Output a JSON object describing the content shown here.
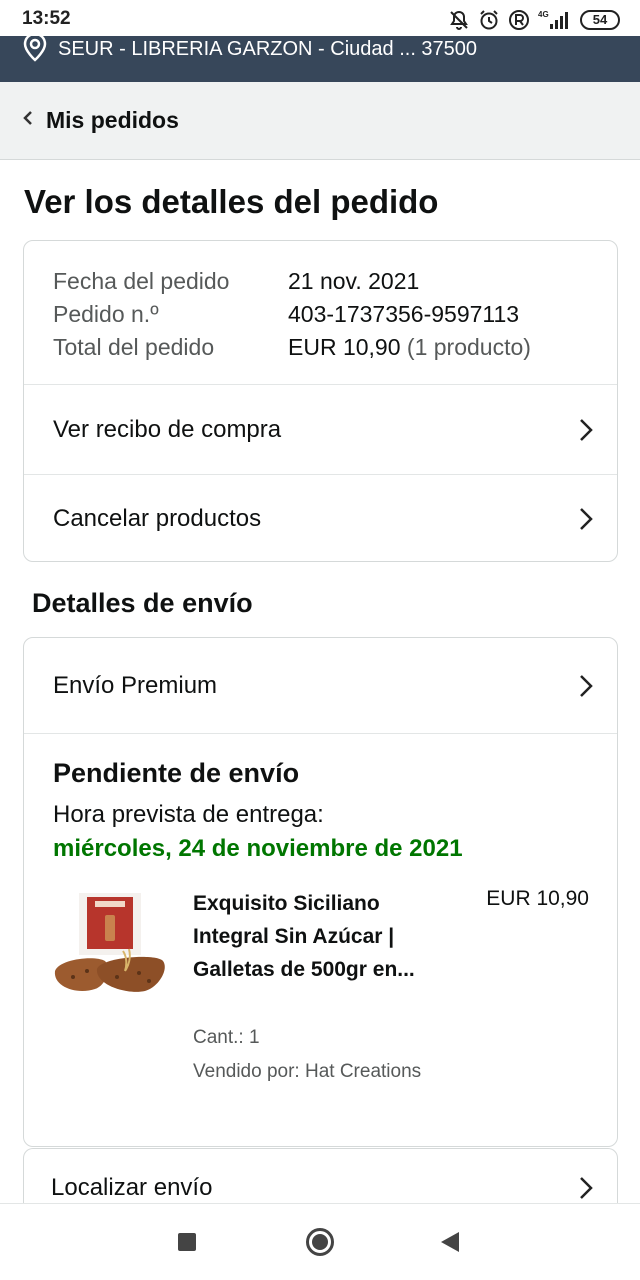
{
  "status_bar": {
    "time": "13:52",
    "network": "4G",
    "battery": "54",
    "icons": [
      "mute-icon",
      "alarm-icon",
      "registered-icon",
      "signal-icon",
      "battery-icon"
    ]
  },
  "address_bar": {
    "icon": "location-pin-icon",
    "text": "SEUR - LIBRERIA GARZON - Ciudad ... 37500"
  },
  "back_nav": {
    "icon": "chevron-left-icon",
    "label": "Mis pedidos"
  },
  "page_title": "Ver los detalles del pedido",
  "order_summary": {
    "rows": [
      {
        "label": "Fecha del pedido",
        "value": "21 nov. 2021",
        "extra": ""
      },
      {
        "label": "Pedido n.º",
        "value": "403-1737356-9597113",
        "extra": ""
      },
      {
        "label": "Total del pedido",
        "value": "EUR 10,90",
        "extra": "(1 producto)"
      }
    ],
    "links": [
      {
        "label": "Ver recibo de compra",
        "icon": "chevron-right-icon"
      },
      {
        "label": "Cancelar productos",
        "icon": "chevron-right-icon"
      }
    ]
  },
  "shipping": {
    "section_title": "Detalles de envío",
    "method": "Envío Premium",
    "status": "Pendiente de envío",
    "eta_label": "Hora prevista de entrega:",
    "eta_date": "miércoles, 24 de noviembre de 2021",
    "eta_color": "#007600",
    "product": {
      "title": "Exquisito Siciliano Integral Sin Azúcar | Galletas de 500gr en...",
      "price": "EUR 10,90",
      "quantity": "Cant.: 1",
      "seller": "Vendido por: Hat Creations"
    }
  },
  "track": {
    "label": "Localizar envío",
    "icon": "chevron-right-icon"
  },
  "nav_bar": {
    "buttons": [
      "recents-square-icon",
      "home-circle-icon",
      "back-triangle-icon"
    ]
  },
  "colors": {
    "address_bar_bg": "#37475a",
    "back_bar_bg": "#f0f2f2",
    "border": "#d5d9d9",
    "secondary_text": "#565959"
  }
}
